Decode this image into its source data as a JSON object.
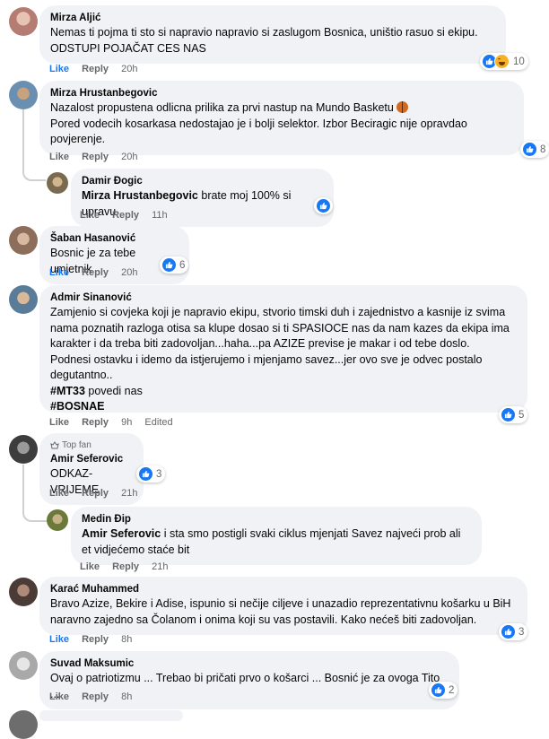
{
  "actions": {
    "like": "Like",
    "reply": "Reply",
    "edited": "Edited"
  },
  "badges": {
    "top_fan": "Top fan"
  },
  "comments": [
    {
      "author": "Mirza Aljić",
      "text": "Nemas ti pojma ti sto si napravio napravio si zaslugom Bosnica, uništio rasuo si ekipu.\nODSTUPI POJAČAT CES NAS",
      "time": "20h",
      "reactions": "10",
      "avatar_color": "#b47c73"
    },
    {
      "author": "Mirza Hrustanbegovic",
      "text": "Nazalost propustena odlicna prilika za prvi nastup na Mundo Basketu",
      "text2": "Pored vodecih kosarkasa nedostajao je i bolji selektor. Izbor Beciragic nije opravdao povjerenje.",
      "time": "20h",
      "reactions": "8",
      "avatar_color": "#6a8fb0"
    },
    {
      "author": "Damir Đogic",
      "mention": "Mirza Hrustanbegovic",
      "text": " brate moj 100% si upravu",
      "time": "11h",
      "avatar_color": "#7a6a4f"
    },
    {
      "author": "Šaban Hasanović",
      "text": "Bosnic je za tebe umjetnik",
      "time": "20h",
      "reactions": "6",
      "avatar_color": "#8c6e5a"
    },
    {
      "author": "Admir Sinanović",
      "text": "Zamjenio si covjeka koji je napravio ekipu, stvorio timski duh i zajednistvo a kasnije iz svima nama poznatih razloga otisa sa klupe dosao si ti SPASIOCE nas da nam kazes da ekipa ima karakter i da treba biti zadovoljan...haha...pa AZIZE previse je makar i od tebe doslo.\nPodnesi ostavku i idemo da istjerujemo i mjenjamo savez...jer ovo sve je odvec postalo degutantno..",
      "hashtag1": "#MT33",
      "hashtag1_rest": " povedi nas",
      "hashtag2": "#BOSNAE",
      "time": "9h",
      "reactions": "5",
      "avatar_color": "#5b7c99"
    },
    {
      "author": "Amir Seferovic",
      "text": "ODKAZ-VRIJEME",
      "time": "21h",
      "reactions": "3",
      "avatar_color": "#3d3d3d"
    },
    {
      "author": "Medin Đip",
      "mention": "Amir Seferovic",
      "text": " i sta smo postigli svaki ciklus mjenjati Savez najveći prob ali et vidjećemo staće bit",
      "time": "21h",
      "avatar_color": "#6b7a3a"
    },
    {
      "author": "Karać Muhammed",
      "text": "Bravo Azize, Bekire i Adise, ispunio si nečije ciljeve i unazadio reprezentativnu košarku u BiH naravno zajedno sa Čolanom i onima koji su vas postavili. Kako nećeš biti zadovoljan.",
      "time": "8h",
      "reactions": "3",
      "avatar_color": "#4a3b36"
    },
    {
      "author": "Suvad Maksumic",
      "text": "Ovaj o patriotizmu ... Trebao bi pričati prvo o košarci ... Bosnić je za ovoga Tito ...",
      "time": "8h",
      "reactions": "2",
      "avatar_color": "#a9a9a9"
    }
  ]
}
